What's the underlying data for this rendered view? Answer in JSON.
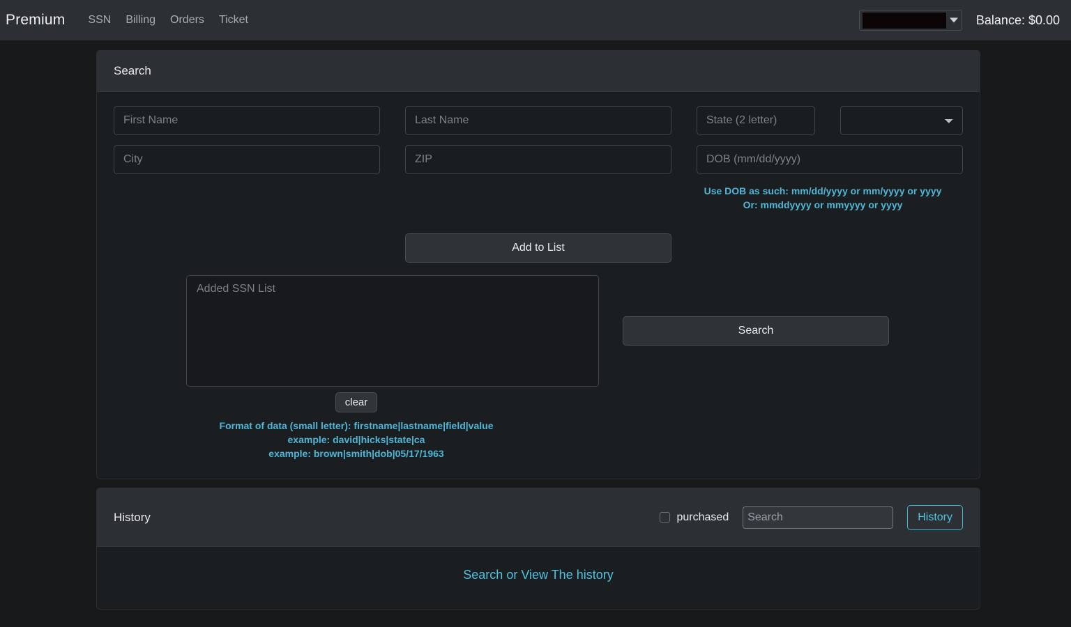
{
  "navbar": {
    "brand": "Premium",
    "links": [
      {
        "label": "SSN"
      },
      {
        "label": "Billing"
      },
      {
        "label": "Orders"
      },
      {
        "label": "Ticket"
      }
    ],
    "account": {
      "value": "",
      "redacted": true,
      "caret_icon": "caret-down-icon"
    },
    "balance": "Balance: $0.00"
  },
  "search_card": {
    "header": "Search",
    "fields": {
      "first_name": {
        "value": "",
        "placeholder": "First Name"
      },
      "last_name": {
        "value": "",
        "placeholder": "Last Name"
      },
      "state": {
        "value": "",
        "placeholder": "State (2 letter)"
      },
      "state_select": {
        "value": "",
        "options": [
          ""
        ],
        "icon": "chevron-down-icon"
      },
      "city": {
        "value": "",
        "placeholder": "City"
      },
      "zip": {
        "value": "",
        "placeholder": "ZIP"
      },
      "dob": {
        "value": "",
        "placeholder": "DOB (mm/dd/yyyy)"
      }
    },
    "dob_hints": [
      "Use DOB as such: mm/dd/yyyy or mm/yyyy or yyyy",
      "Or: mmddyyyy or mmyyyy or yyyy"
    ],
    "add_to_list_label": "Add to List",
    "ssn_list": {
      "value": "",
      "placeholder": "Added SSN List"
    },
    "search_label": "Search",
    "clear_label": "clear",
    "format_hints": [
      "Format of data (small letter): firstname|lastname|field|value",
      "example: david|hicks|state|ca",
      "example: brown|smith|dob|05/17/1963"
    ]
  },
  "history_card": {
    "header": "History",
    "purchased_label": "purchased",
    "purchased_checked": false,
    "search": {
      "value": "",
      "placeholder": "Search"
    },
    "history_button_label": "History",
    "body_link": "Search or View The history"
  },
  "colors": {
    "page_bg": "#16181a",
    "navbar_bg": "#2c3034",
    "card_bg": "#1b1e21",
    "card_header_bg": "#2c3034",
    "accent_cyan": "#4fc3e0",
    "hint_cyan": "#4fb6d6",
    "text_primary": "#e9ecef",
    "text_muted": "#7c8287"
  }
}
